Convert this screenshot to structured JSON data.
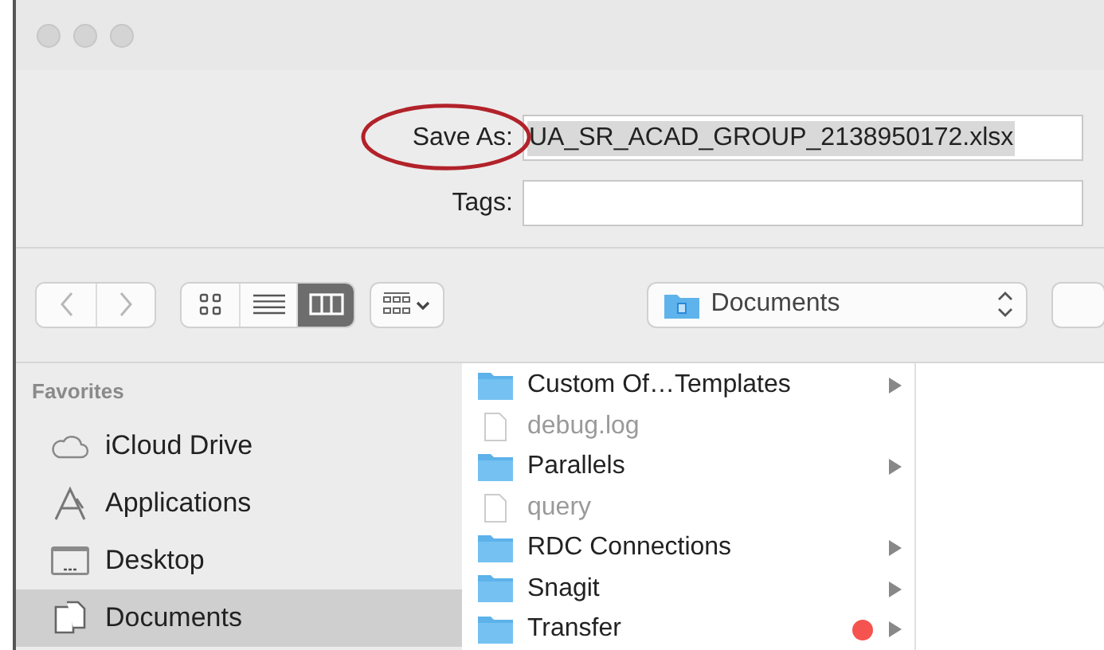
{
  "save_as": {
    "label": "Save As:",
    "value": "UA_SR_ACAD_GROUP_2138950172.xlsx",
    "selected": true
  },
  "tags": {
    "label": "Tags:"
  },
  "toolbar": {
    "view_modes": [
      {
        "kind": "icons",
        "selected": false
      },
      {
        "kind": "list",
        "selected": false
      },
      {
        "kind": "columns",
        "selected": true
      }
    ],
    "location": "Documents"
  },
  "sidebar": {
    "heading": "Favorites",
    "items": [
      {
        "label": "iCloud Drive",
        "kind": "cloud",
        "selected": false
      },
      {
        "label": "Applications",
        "kind": "apps",
        "selected": false
      },
      {
        "label": "Desktop",
        "kind": "desktop",
        "selected": false
      },
      {
        "label": "Documents",
        "kind": "documents",
        "selected": true
      }
    ]
  },
  "files": [
    {
      "name": "Custom Of…Templates",
      "kind": "folder"
    },
    {
      "name": "debug.log",
      "kind": "file"
    },
    {
      "name": "Parallels",
      "kind": "folder"
    },
    {
      "name": "query",
      "kind": "file"
    },
    {
      "name": "RDC Connections",
      "kind": "folder"
    },
    {
      "name": "Snagit",
      "kind": "folder"
    },
    {
      "name": "Transfer",
      "kind": "folder",
      "color": "#f5534f"
    }
  ]
}
